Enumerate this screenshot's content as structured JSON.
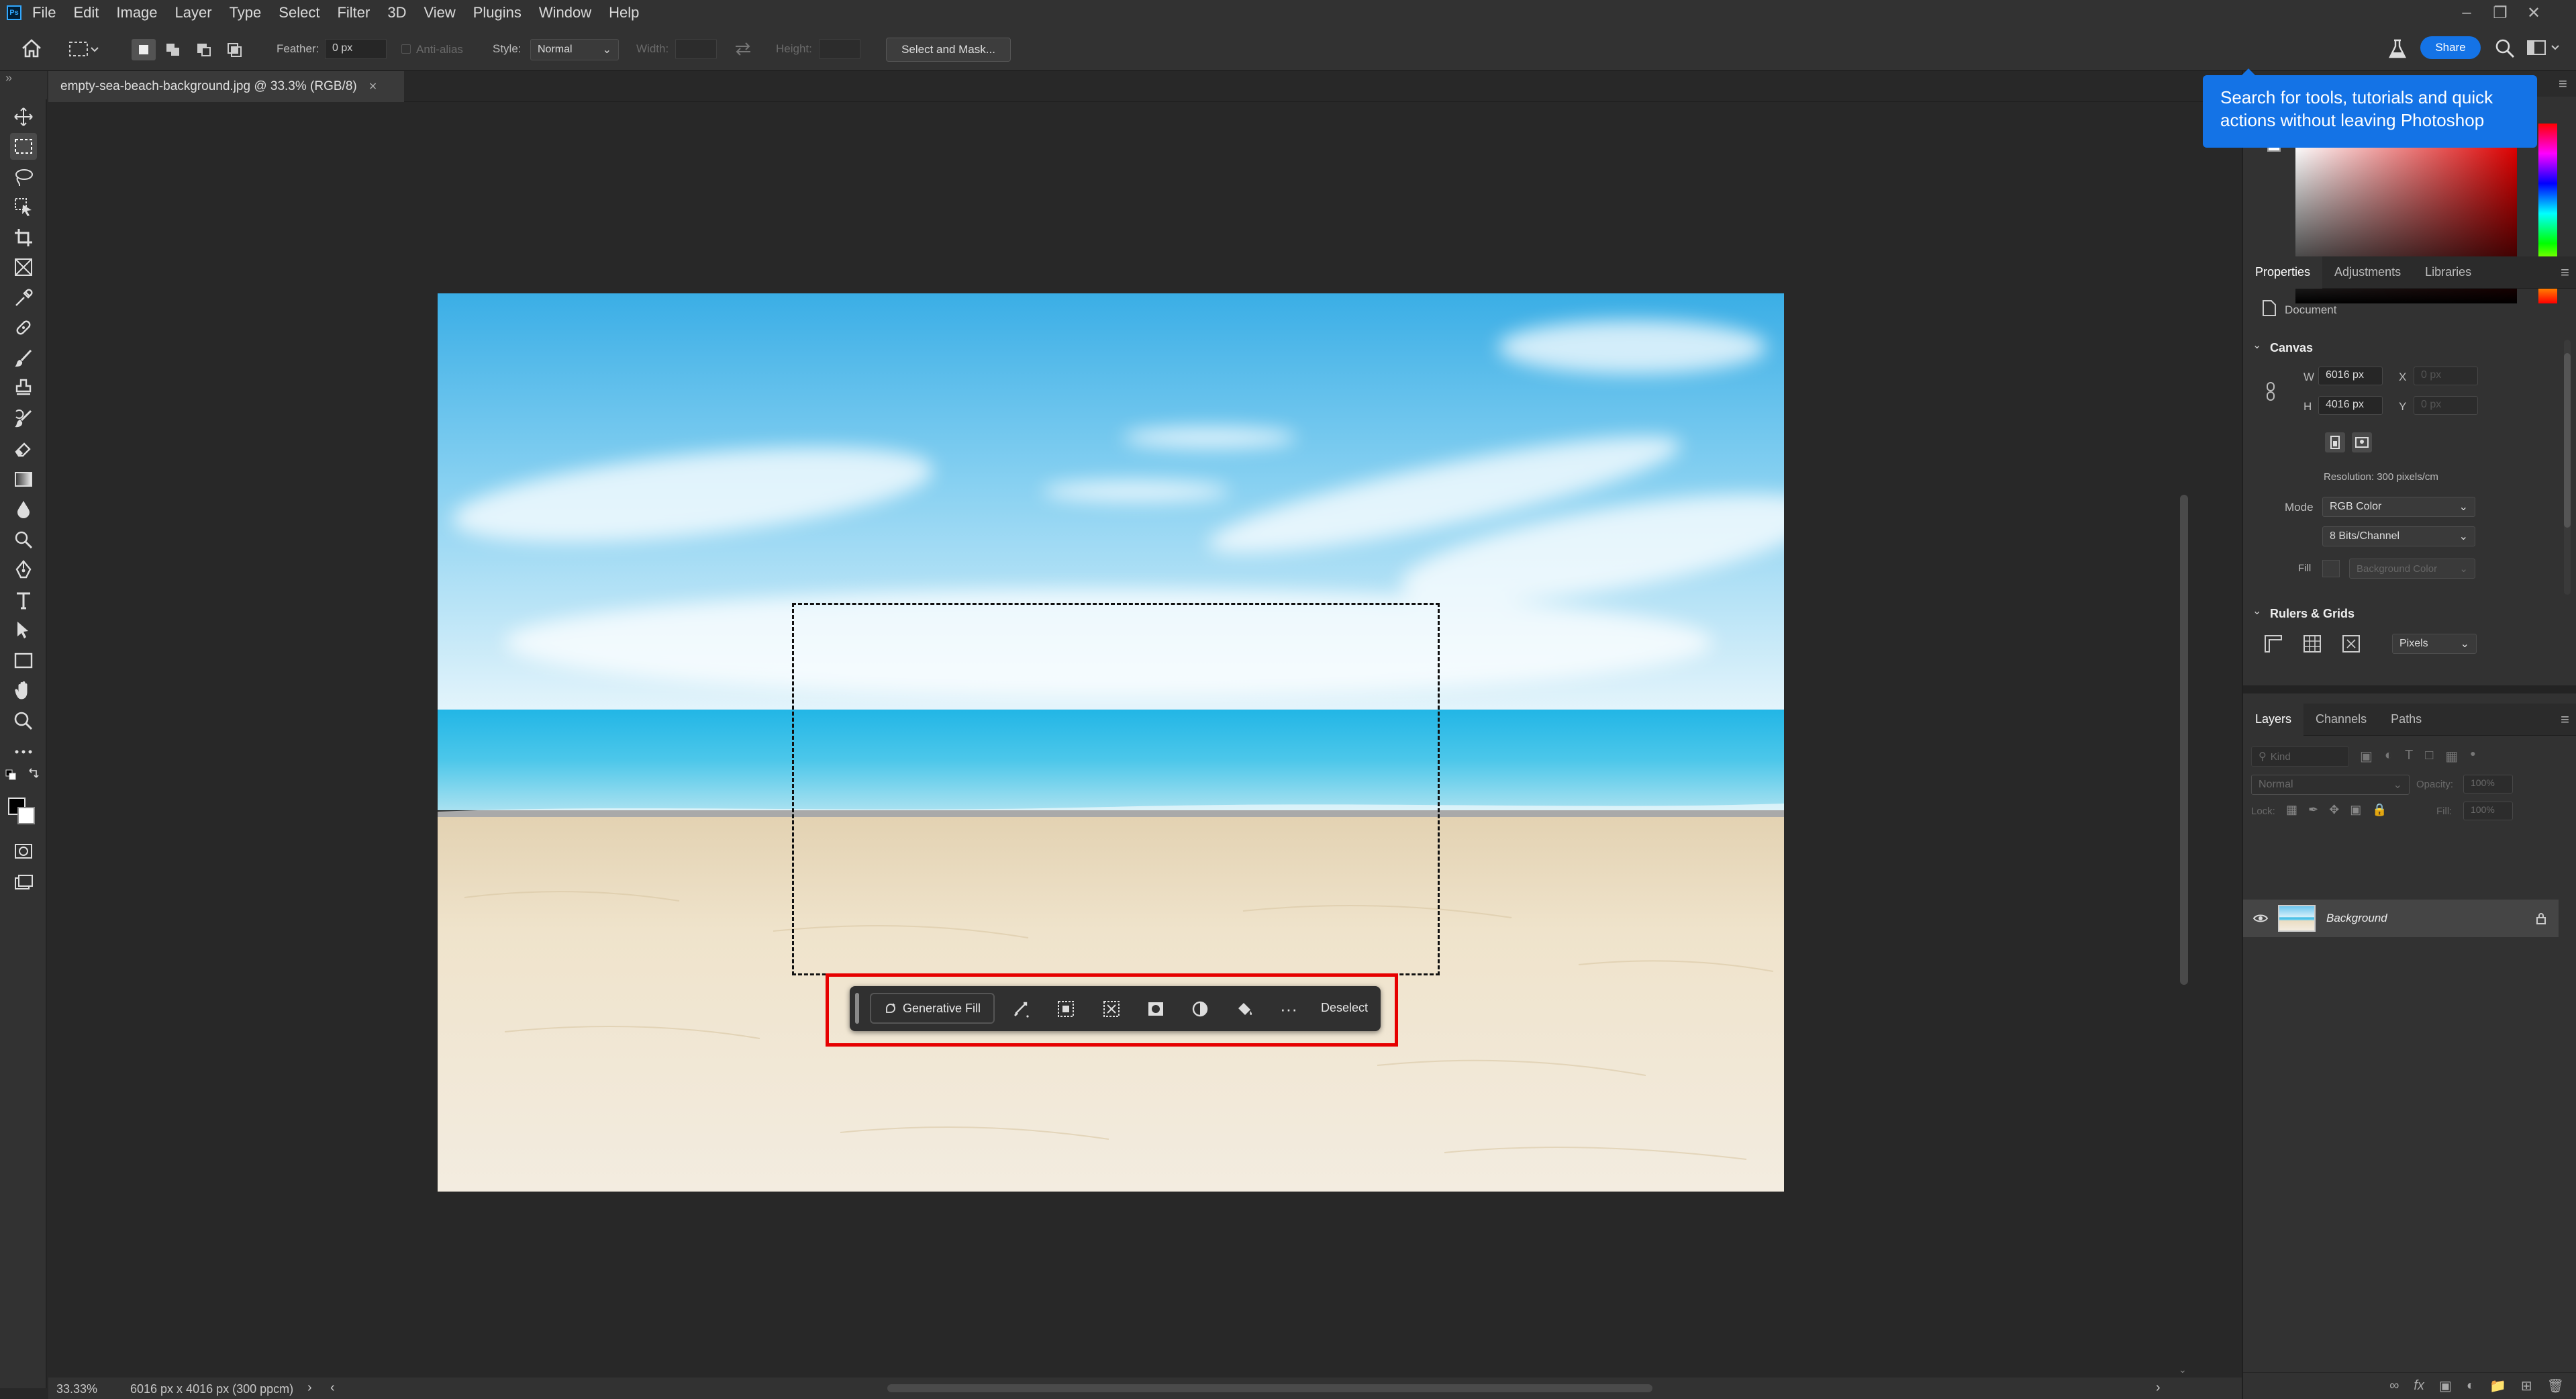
{
  "app": {
    "logo_text": "Ps"
  },
  "menu": [
    "File",
    "Edit",
    "Image",
    "Layer",
    "Type",
    "Select",
    "Filter",
    "3D",
    "View",
    "Plugins",
    "Window",
    "Help"
  ],
  "options": {
    "feather_label": "Feather:",
    "feather_value": "0 px",
    "antialias_label": "Anti-alias",
    "style_label": "Style:",
    "style_value": "Normal",
    "width_label": "Width:",
    "height_label": "Height:",
    "select_mask_label": "Select and Mask...",
    "share_label": "Share"
  },
  "document": {
    "tab_title": "empty-sea-beach-background.jpg @ 33.3% (RGB/8)",
    "close_glyph": "×"
  },
  "context_bar": {
    "generative_fill_label": "Generative Fill",
    "deselect_label": "Deselect",
    "more_glyph": "···"
  },
  "status": {
    "zoom": "33.33%",
    "doc_size": "6016 px x 4016 px (300 ppcm)"
  },
  "tooltip": {
    "text": "Search for tools, tutorials and quick actions without leaving Photoshop"
  },
  "properties": {
    "tabs": [
      "Properties",
      "Adjustments",
      "Libraries"
    ],
    "doc_label": "Document",
    "canvas_title": "Canvas",
    "w_label": "W",
    "w_value": "6016 px",
    "h_label": "H",
    "h_value": "4016 px",
    "x_label": "X",
    "x_value": "0 px",
    "y_label": "Y",
    "y_value": "0 px",
    "resolution": "Resolution: 300 pixels/cm",
    "mode_label": "Mode",
    "mode_value": "RGB Color",
    "bits_value": "8 Bits/Channel",
    "fill_label": "Fill",
    "fill_value": "Background Color",
    "rulers_title": "Rulers & Grids",
    "units_value": "Pixels"
  },
  "layers": {
    "tabs": [
      "Layers",
      "Channels",
      "Paths"
    ],
    "kind_placeholder": "Kind",
    "blend_value": "Normal",
    "opacity_label": "Opacity:",
    "opacity_value": "100%",
    "lock_label": "Lock:",
    "fill_label": "Fill:",
    "fill_value": "100%",
    "layer_name": "Background"
  },
  "colors": {
    "accent": "#1473e6",
    "highlight": "#e60000",
    "ui_bg": "#323232",
    "canvas_bg": "#282828"
  }
}
